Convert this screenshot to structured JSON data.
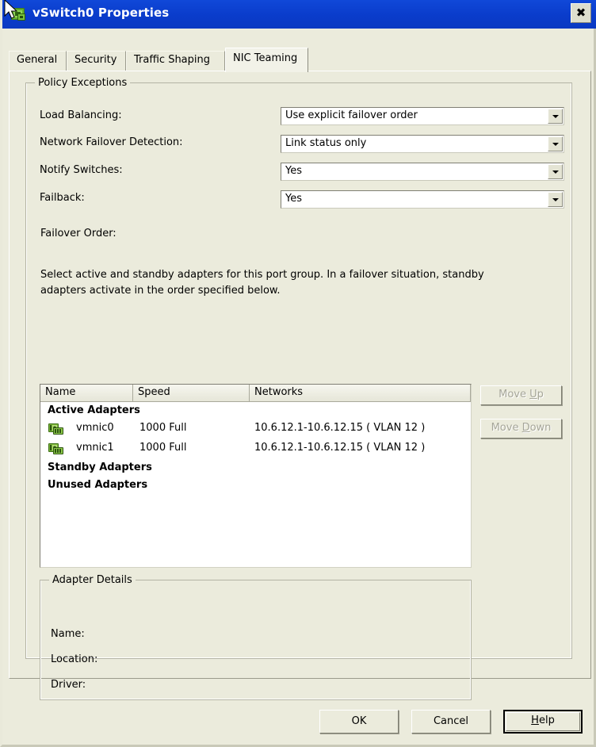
{
  "window": {
    "title": "vSwitch0 Properties",
    "app_icon": "vswitch-icon",
    "close_label": "✖",
    "titlebar_color": "#0a3ccb",
    "dialog_bg": "#ebebdc"
  },
  "tabs": [
    {
      "label": "General",
      "active": false
    },
    {
      "label": "Security",
      "active": false
    },
    {
      "label": "Traffic Shaping",
      "active": false
    },
    {
      "label": "NIC Teaming",
      "active": true
    }
  ],
  "policy_exceptions": {
    "group_title": "Policy Exceptions",
    "fields": [
      {
        "label": "Load Balancing:",
        "value": "Use explicit failover order"
      },
      {
        "label": "Network Failover Detection:",
        "value": "Link status only"
      },
      {
        "label": "Notify Switches:",
        "value": "Yes"
      },
      {
        "label": "Failback:",
        "value": "Yes"
      }
    ],
    "failover_order_label": "Failover Order:",
    "description_line1": "Select active and standby adapters for this port group.  In a failover situation, standby",
    "description_line2": "adapters activate  in the order specified below."
  },
  "adapter_list": {
    "columns": [
      "Name",
      "Speed",
      "Networks"
    ],
    "groups": [
      {
        "title": "Active Adapters",
        "rows": [
          {
            "name": "vmnic0",
            "speed": "1000 Full",
            "networks": "10.6.12.1-10.6.12.15 ( VLAN 12 )"
          },
          {
            "name": "vmnic1",
            "speed": "1000 Full",
            "networks": "10.6.12.1-10.6.12.15 ( VLAN 12 )"
          }
        ]
      },
      {
        "title": "Standby Adapters",
        "rows": []
      },
      {
        "title": "Unused Adapters",
        "rows": []
      }
    ]
  },
  "order_buttons": {
    "move_up": {
      "label": "Move Up",
      "accel": "U",
      "disabled": true
    },
    "move_down": {
      "label": "Move Down",
      "accel": "D",
      "disabled": true
    }
  },
  "adapter_details": {
    "group_title": "Adapter Details",
    "rows": [
      {
        "label": "Name:",
        "value": ""
      },
      {
        "label": "Location:",
        "value": ""
      },
      {
        "label": "Driver:",
        "value": ""
      }
    ]
  },
  "dialog_buttons": {
    "ok": "OK",
    "cancel": "Cancel",
    "help": "Help",
    "help_accel": "H"
  }
}
